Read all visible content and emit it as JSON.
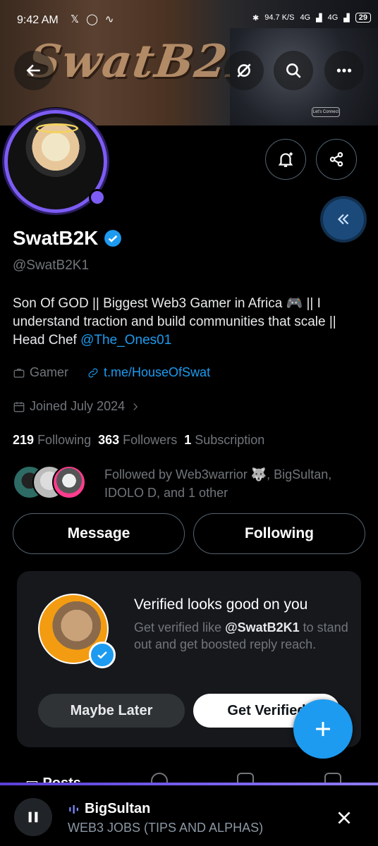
{
  "status_bar": {
    "time": "9:42 AM",
    "net_speed": "94.7 K/S",
    "net1": "4G",
    "net2": "4G",
    "battery": "29"
  },
  "banner": {
    "wordmark": "SwatB2K",
    "badge": "Let's Connect"
  },
  "profile": {
    "name": "SwatB2K",
    "handle": "@SwatB2K1",
    "bio_text": "Son Of GOD || Biggest Web3 Gamer in Africa 🎮 || I understand traction and build communities that scale || Head Chef ",
    "bio_mention": "@The_Ones01",
    "category": "Gamer",
    "link": "t.me/HouseOfSwat",
    "joined": "Joined July 2024",
    "following_count": "219",
    "following_label": "Following",
    "followers_count": "363",
    "followers_label": "Followers",
    "subscriptions_count": "1",
    "subscriptions_label": "Subscription",
    "followed_by": "Followed by Web3warrior 🐺, BigSultan, IDOLO D, and 1 other"
  },
  "actions": {
    "message": "Message",
    "following": "Following"
  },
  "verify_card": {
    "title": "Verified looks good on you",
    "text_pre": "Get verified like ",
    "text_handle": "@SwatB2K1",
    "text_post": " to stand out and get boosted reply reach.",
    "later": "Maybe Later",
    "verify": "Get Verified"
  },
  "tabs": {
    "posts": "Posts"
  },
  "player": {
    "host": "BigSultan",
    "title": "WEB3 JOBS (TIPS AND ALPHAS)"
  },
  "colors": {
    "accent": "#1d9bf0",
    "ring": "#7c5cf4"
  }
}
